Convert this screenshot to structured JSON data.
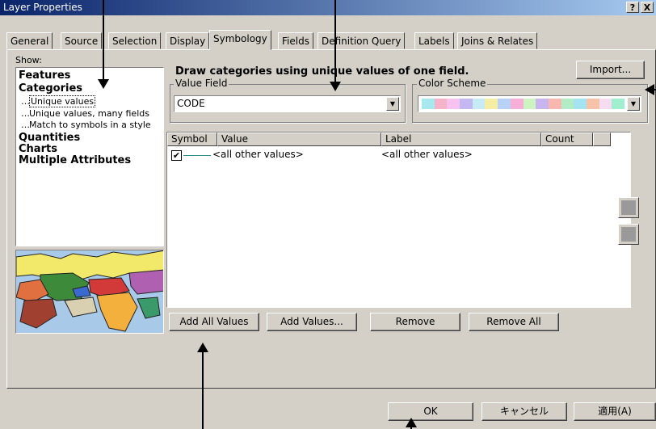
{
  "window": {
    "title": "Layer Properties",
    "help_btn": "?",
    "close_btn": "X"
  },
  "tabs": [
    {
      "label": "General"
    },
    {
      "label": "Source"
    },
    {
      "label": "Selection"
    },
    {
      "label": "Display"
    },
    {
      "label": "Symbology"
    },
    {
      "label": "Fields"
    },
    {
      "label": "Definition Query"
    },
    {
      "label": "Labels"
    },
    {
      "label": "Joins & Relates"
    }
  ],
  "show": {
    "label": "Show:",
    "items": [
      {
        "label": "Features",
        "type": "bold"
      },
      {
        "label": "Categories",
        "type": "bold"
      },
      {
        "label": "Unique values",
        "type": "sub",
        "selected": true
      },
      {
        "label": "Unique values, many fields",
        "type": "sub"
      },
      {
        "label": "Match to symbols in a style",
        "type": "sub"
      },
      {
        "label": "Quantities",
        "type": "bold"
      },
      {
        "label": "Charts",
        "type": "bold"
      },
      {
        "label": "Multiple Attributes",
        "type": "bold"
      }
    ]
  },
  "description": "Draw categories using unique values of one field.",
  "import_btn": "Import...",
  "value_field": {
    "label": "Value Field",
    "value": "CODE"
  },
  "color_scheme": {
    "label": "Color Scheme",
    "colors": [
      "#a7e8ee",
      "#f5b3c9",
      "#f8c2f0",
      "#c4b8f3",
      "#c7eaf7",
      "#f4eda3",
      "#b9d1f7",
      "#f6b0d8",
      "#cdf3c0",
      "#c8b4ee",
      "#f9b7b0",
      "#b2ecc4",
      "#a4e4f0",
      "#f7c3a8",
      "#f5dcf0",
      "#a0f0d0"
    ]
  },
  "table": {
    "columns": [
      "Symbol",
      "Value",
      "Label",
      "Count"
    ],
    "rows": [
      {
        "checked": true,
        "value": "<all other values>",
        "label": "<all other values>",
        "count": ""
      }
    ]
  },
  "buttons": {
    "add_all": "Add All Values",
    "add_values": "Add Values...",
    "remove": "Remove",
    "remove_all": "Remove All"
  },
  "footer": {
    "ok": "OK",
    "cancel": "キャンセル",
    "apply": "適用(A)"
  }
}
